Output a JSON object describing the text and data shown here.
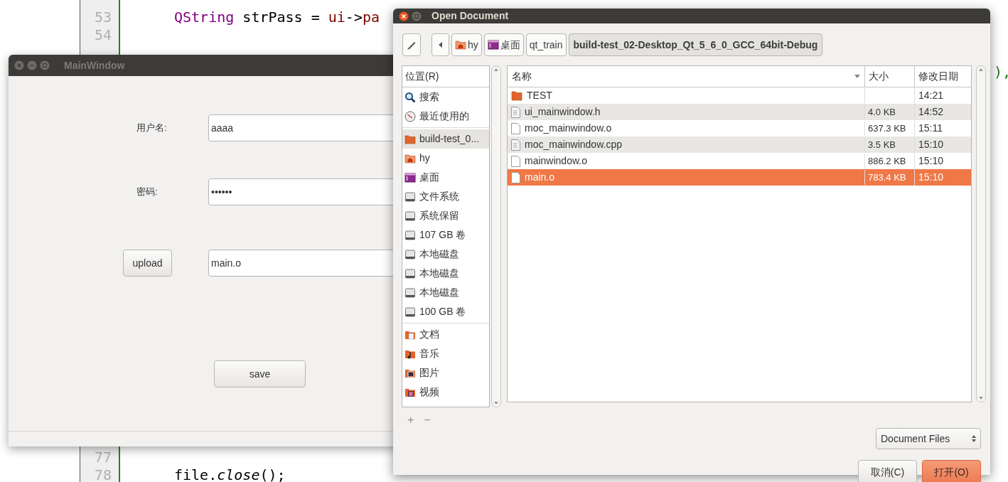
{
  "editor": {
    "top_lines": [
      {
        "number": "53",
        "tokens": [
          {
            "text": "QString",
            "kind": "type"
          },
          {
            "text": " strPass = ",
            "kind": "plain"
          },
          {
            "text": "ui",
            "kind": "member"
          },
          {
            "text": "->",
            "kind": "plain"
          },
          {
            "text": "pa",
            "kind": "member"
          }
        ]
      },
      {
        "number": "54"
      }
    ],
    "bottom_lines": [
      {
        "number": "77"
      },
      {
        "number": "78",
        "tokens": [
          {
            "text": "file.",
            "kind": "plain"
          },
          {
            "text": "close",
            "kind": "method"
          },
          {
            "text": "();",
            "kind": "plain"
          }
        ]
      }
    ],
    "fragment": "),"
  },
  "main_window": {
    "title": "MainWindow",
    "fields": [
      {
        "label": "用户名:",
        "value": "aaaa",
        "kind": "text"
      },
      {
        "label": "密码:",
        "value": "••••••",
        "kind": "text"
      },
      {
        "label": "upload",
        "value": "main.o",
        "kind": "button"
      }
    ],
    "save_button": "save"
  },
  "dialog": {
    "title": "Open Document",
    "path": [
      {
        "label": "hy",
        "kind": "home",
        "selected": false
      },
      {
        "label": "桌面",
        "kind": "desktop",
        "selected": false
      },
      {
        "label": "qt_train",
        "kind": "plain",
        "selected": false
      },
      {
        "label": "build-test_02-Desktop_Qt_5_6_0_GCC_64bit-Debug",
        "kind": "plain",
        "selected": true
      }
    ],
    "places_header": "位置(R)",
    "places": [
      [
        {
          "label": "搜索",
          "kind": "search",
          "selected": false
        },
        {
          "label": "最近使用的",
          "kind": "recent",
          "selected": false
        }
      ],
      [
        {
          "label": "build-test_0...",
          "kind": "folder",
          "selected": true
        },
        {
          "label": "hy",
          "kind": "home",
          "selected": false
        },
        {
          "label": "桌面",
          "kind": "desktop",
          "selected": false
        },
        {
          "label": "文件系统",
          "kind": "drive",
          "selected": false
        },
        {
          "label": "系统保留",
          "kind": "drive",
          "selected": false
        },
        {
          "label": "107 GB 卷",
          "kind": "drive",
          "selected": false
        },
        {
          "label": "本地磁盘",
          "kind": "drive",
          "selected": false
        },
        {
          "label": "本地磁盘",
          "kind": "drive",
          "selected": false
        },
        {
          "label": "本地磁盘",
          "kind": "drive",
          "selected": false
        },
        {
          "label": "100 GB 卷",
          "kind": "drive",
          "selected": false
        }
      ],
      [
        {
          "label": "文档",
          "kind": "documents",
          "selected": false
        },
        {
          "label": "音乐",
          "kind": "music",
          "selected": false
        },
        {
          "label": "图片",
          "kind": "pictures",
          "selected": false
        },
        {
          "label": "视频",
          "kind": "videos",
          "selected": false
        }
      ]
    ],
    "columns": [
      "名称",
      "大小",
      "修改日期"
    ],
    "files": [
      {
        "name": "TEST",
        "modified": "14:21",
        "kind": "folder",
        "selected": false
      },
      {
        "name": "ui_mainwindow.h",
        "size": "4.0 KB",
        "modified": "14:52",
        "kind": "source",
        "selected": false
      },
      {
        "name": "moc_mainwindow.o",
        "size": "637.3 KB",
        "modified": "15:11",
        "kind": "file",
        "selected": false
      },
      {
        "name": "moc_mainwindow.cpp",
        "size": "3.5 KB",
        "modified": "15:10",
        "kind": "source",
        "selected": false
      },
      {
        "name": "mainwindow.o",
        "size": "886.2 KB",
        "modified": "15:10",
        "kind": "file",
        "selected": false
      },
      {
        "name": "main.o",
        "size": "783.4 KB",
        "modified": "15:10",
        "kind": "file",
        "selected": true
      }
    ],
    "add_label": "+",
    "remove_label": "−",
    "filter": "Document Files",
    "cancel": "取消(C)",
    "open": "打开(O)"
  }
}
